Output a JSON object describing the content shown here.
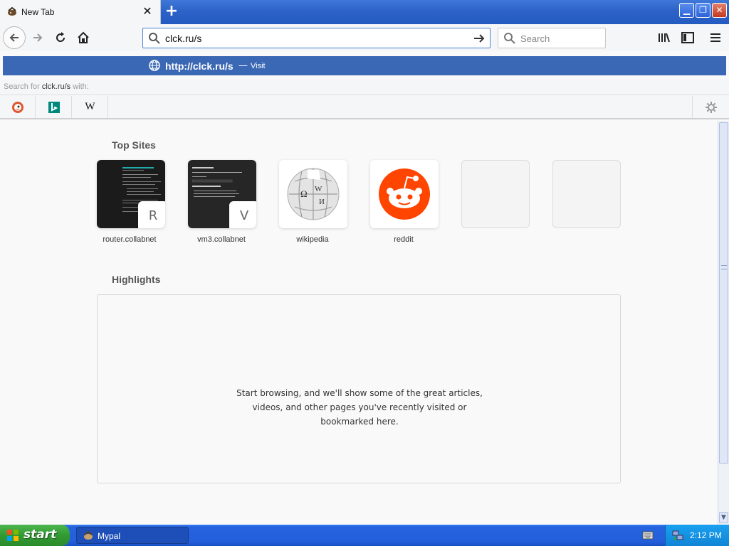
{
  "browser": {
    "tab": {
      "title": "New Tab"
    },
    "url_bar": {
      "value": "clck.ru/s"
    },
    "search_bar": {
      "placeholder": "Search"
    }
  },
  "autocomplete": {
    "visit_url": "http://clck.ru/s",
    "visit_separator": "—",
    "visit_label": "Visit",
    "search_for_prefix": "Search for",
    "search_for_query": "clck.ru/s",
    "search_for_suffix": "with:",
    "engines": [
      "duckduckgo-icon",
      "bing-icon",
      "wikipedia-icon"
    ],
    "wikipedia_glyph": "W"
  },
  "newtab": {
    "top_sites_title": "Top Sites",
    "top_sites": [
      {
        "label": "router.collabnet",
        "letter": "R"
      },
      {
        "label": "vm3.collabnet",
        "letter": "V"
      },
      {
        "label": "wikipedia",
        "letter": ""
      },
      {
        "label": "reddit",
        "letter": ""
      }
    ],
    "highlights_title": "Highlights",
    "highlights_message_lines": [
      "Start browsing, and we'll show some of the great articles,",
      "videos, and other pages you've recently visited or",
      "bookmarked here."
    ]
  },
  "taskbar": {
    "start_label": "start",
    "window_label": "Mypal",
    "clock": "2:12 PM"
  },
  "colors": {
    "visit_row": "#3b68b4",
    "reddit": "#ff4500",
    "taskbar": "#245edb"
  }
}
